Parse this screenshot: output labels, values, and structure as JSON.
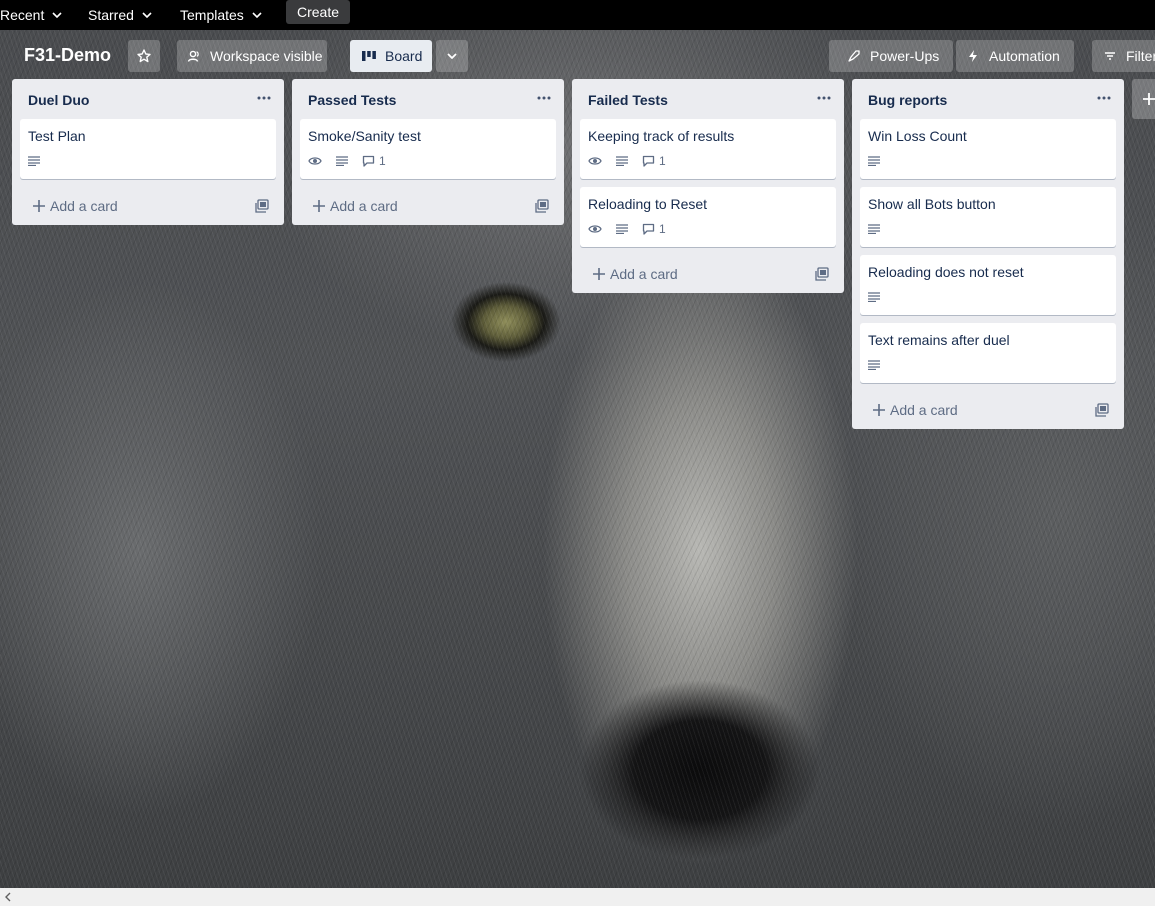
{
  "nav": {
    "recent": "Recent",
    "starred": "Starred",
    "templates": "Templates",
    "create": "Create"
  },
  "board": {
    "title": "F31-Demo",
    "visibility": "Workspace visible",
    "view": "Board",
    "power_ups": "Power-Ups",
    "automation": "Automation",
    "filter": "Filter"
  },
  "add_card_label": "Add a card",
  "lists": [
    {
      "title": "Duel Duo",
      "cards": [
        {
          "title": "Test Plan",
          "watch": false,
          "description": true,
          "comments": ""
        }
      ]
    },
    {
      "title": "Passed Tests",
      "cards": [
        {
          "title": "Smoke/Sanity test",
          "watch": true,
          "description": true,
          "comments": "1"
        }
      ]
    },
    {
      "title": "Failed Tests",
      "cards": [
        {
          "title": "Keeping track of results",
          "watch": true,
          "description": true,
          "comments": "1"
        },
        {
          "title": "Reloading to Reset",
          "watch": true,
          "description": true,
          "comments": "1"
        }
      ]
    },
    {
      "title": "Bug reports",
      "cards": [
        {
          "title": "Win Loss Count",
          "watch": false,
          "description": true,
          "comments": ""
        },
        {
          "title": "Show all Bots button",
          "watch": false,
          "description": true,
          "comments": ""
        },
        {
          "title": "Reloading does not reset",
          "watch": false,
          "description": true,
          "comments": ""
        },
        {
          "title": "Text remains after duel",
          "watch": false,
          "description": true,
          "comments": ""
        }
      ]
    }
  ],
  "colors": {
    "list_bg": "#ebecf0",
    "text_primary": "#172b4d",
    "text_muted": "#5e6c84",
    "topbar": "#000000"
  }
}
